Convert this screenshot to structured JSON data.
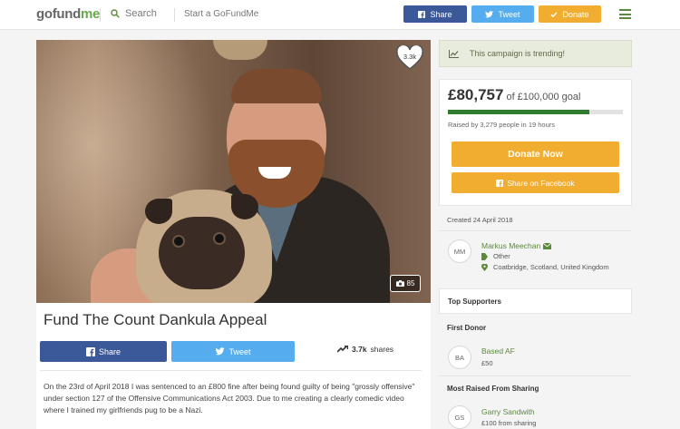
{
  "header": {
    "logo_main": "gofund",
    "logo_accent": "me",
    "search_label": "Search",
    "start_label": "Start a GoFundMe",
    "share_label": "Share",
    "tweet_label": "Tweet",
    "donate_label": "Donate"
  },
  "hero": {
    "heart_count": "3.3k",
    "photo_count": "85"
  },
  "campaign": {
    "title": "Fund The Count Dankula Appeal",
    "share_label": "Share",
    "tweet_label": "Tweet",
    "shares_count": "3.7k",
    "shares_label": "shares",
    "story": "On the 23rd of April 2018 I was sentenced to an £800 fine after being found guilty of being \"grossly offensive\" under section 127 of the Offensive Communications Act 2003. Due to me creating a clearly comedic video where I trained my girlfriends pug to be a Nazi."
  },
  "sidebar": {
    "trending": "This campaign is trending!",
    "raised": "£80,757",
    "goal": "of £100,000 goal",
    "progress_fraction": 0.808,
    "raised_by": "Raised by 3,279 people in 19 hours",
    "donate_now": "Donate Now",
    "share_facebook": "Share on Facebook",
    "created": "Created 24 April 2018",
    "organizer": {
      "initials": "MM",
      "name": "Markus Meechan",
      "category": "Other",
      "location": "Coatbridge, Scotland, United Kingdom"
    },
    "top_supporters": "Top Supporters",
    "first_donor_label": "First Donor",
    "first_donor": {
      "initials": "BA",
      "name": "Based AF",
      "amount": "£50"
    },
    "most_raised_label": "Most Raised From Sharing",
    "most_raised": {
      "initials": "GS",
      "name": "Garry Sandwith",
      "amount": "£100 from sharing"
    }
  },
  "colors": {
    "facebook": "#3b5998",
    "twitter": "#55acee",
    "donate": "#f0ad30",
    "brand_green": "#5a8a3a",
    "progress": "#2e7d2e"
  }
}
